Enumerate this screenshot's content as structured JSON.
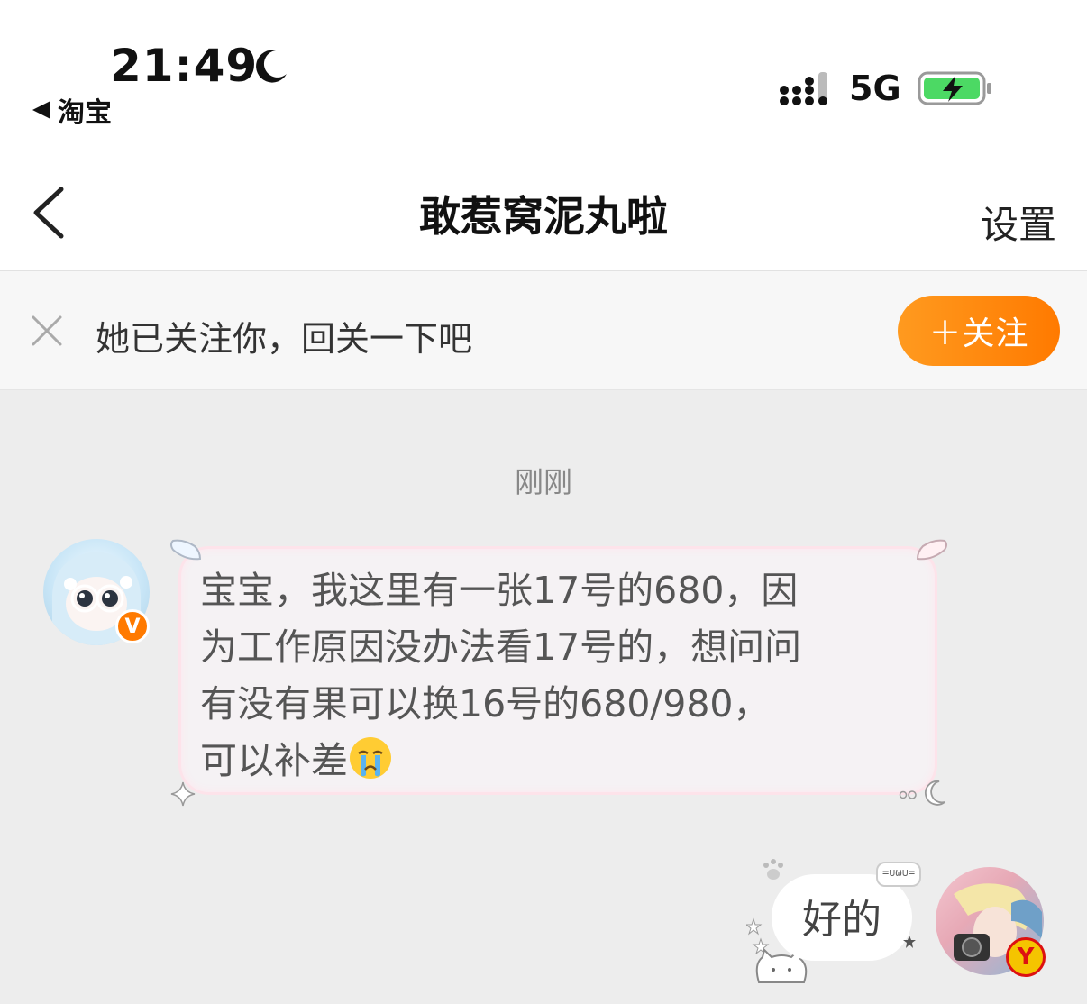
{
  "status_bar": {
    "time": "21:49",
    "back_app": "淘宝",
    "network": "5G",
    "icons": [
      "moon-icon",
      "signal-icon",
      "battery-charging-icon"
    ]
  },
  "nav": {
    "title": "敢惹窝泥丸啦",
    "settings": "设置",
    "icons": [
      "back-chevron-icon"
    ]
  },
  "banner": {
    "text": "她已关注你，回关一下吧",
    "follow_button": "＋关注",
    "icons": [
      "close-icon"
    ]
  },
  "chat": {
    "timestamp": "刚刚",
    "messages": [
      {
        "side": "left",
        "lines": [
          "宝宝，我这里有一张17号的680，因",
          "为工作原因没办法看17号的，想问问",
          "有没有果可以换16号的680/980，",
          "可以补差"
        ],
        "emoji": "crying-face-icon",
        "badge": "V"
      },
      {
        "side": "right",
        "text": "好的",
        "sticker": "=∪ω∪=",
        "badge": "Y"
      }
    ]
  },
  "colors": {
    "accent": "#ff8a00",
    "bubble_border": "#fde3ea",
    "background": "#ededed"
  }
}
